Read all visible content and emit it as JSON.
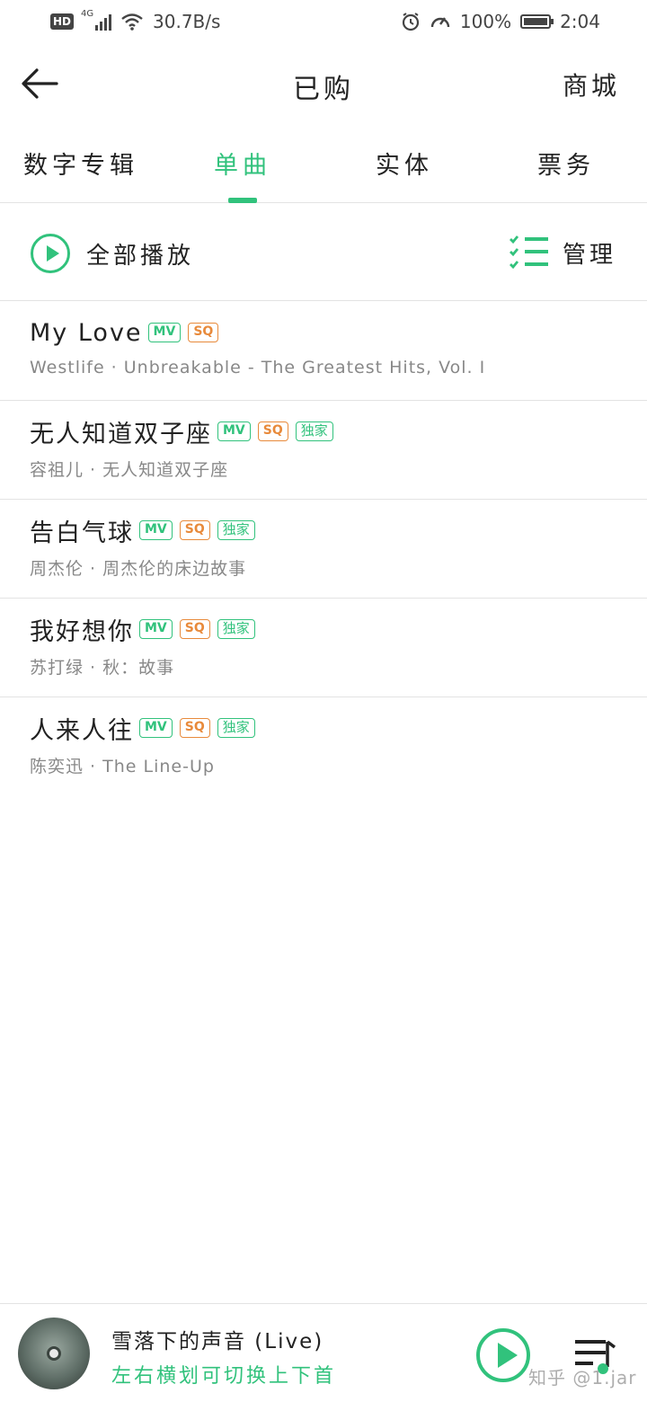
{
  "status_bar": {
    "hd": "HD",
    "network": "4G",
    "speed": "30.7B/s",
    "battery": "100%",
    "time": "2:04"
  },
  "header": {
    "title": "已购",
    "right_link": "商城",
    "back_icon": "back-arrow-icon"
  },
  "tabs": [
    {
      "label": "数字专辑",
      "active": false
    },
    {
      "label": "单曲",
      "active": true
    },
    {
      "label": "实体",
      "active": false
    },
    {
      "label": "票务",
      "active": false
    }
  ],
  "actions": {
    "play_all": "全部播放",
    "manage": "管理"
  },
  "badges": {
    "mv": "MV",
    "sq": "SQ",
    "exclusive": "独家"
  },
  "songs": [
    {
      "title": "My Love",
      "subtitle": "Westlife · Unbreakable - The Greatest Hits, Vol. I",
      "mv": true,
      "sq": true,
      "exclusive": false
    },
    {
      "title": "无人知道双子座",
      "subtitle": "容祖儿 · 无人知道双子座",
      "mv": true,
      "sq": true,
      "exclusive": true
    },
    {
      "title": "告白气球",
      "subtitle": "周杰伦 · 周杰伦的床边故事",
      "mv": true,
      "sq": true,
      "exclusive": true
    },
    {
      "title": "我好想你",
      "subtitle": "苏打绿 · 秋：故事",
      "mv": true,
      "sq": true,
      "exclusive": true
    },
    {
      "title": "人来人往",
      "subtitle": "陈奕迅 · The Line-Up",
      "mv": true,
      "sq": true,
      "exclusive": true
    }
  ],
  "player": {
    "title": "雪落下的声音 (Live)",
    "hint": "左右横划可切换上下首",
    "watermark": "知乎 @1.jar"
  },
  "colors": {
    "accent": "#31c27c",
    "sq": "#e88a3b",
    "text": "#222222",
    "subtext": "#888888",
    "divider": "#e3e3e3"
  }
}
